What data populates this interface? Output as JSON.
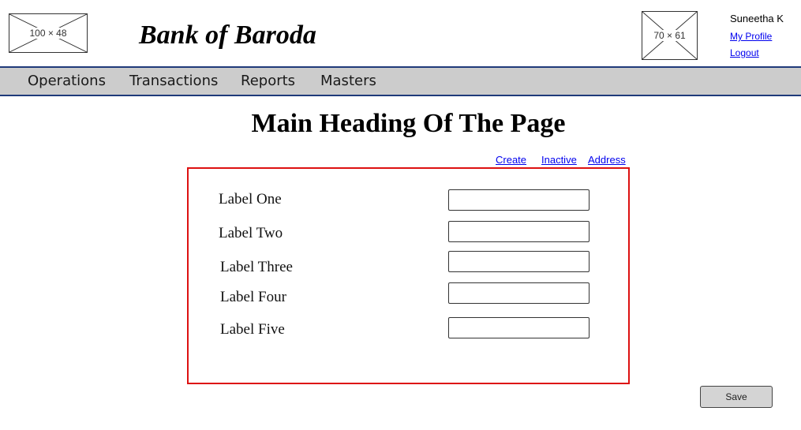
{
  "header": {
    "logo_placeholder": "100 × 48",
    "bank_name": "Bank of Baroda",
    "avatar_placeholder": "70 × 61",
    "user": {
      "name": "Suneetha K",
      "my_profile": "My Profile",
      "logout": "Logout"
    }
  },
  "nav": {
    "items": [
      {
        "label": "Operations"
      },
      {
        "label": "Transactions"
      },
      {
        "label": "Reports"
      },
      {
        "label": "Masters"
      }
    ]
  },
  "main": {
    "heading": "Main Heading Of The Page",
    "actions": [
      {
        "label": "Create"
      },
      {
        "label": "Inactive"
      },
      {
        "label": "Address"
      }
    ],
    "form": {
      "fields": [
        {
          "label": "Label One",
          "value": ""
        },
        {
          "label": "Label Two",
          "value": ""
        },
        {
          "label": "Label Three",
          "value": ""
        },
        {
          "label": "Label Four",
          "value": ""
        },
        {
          "label": "Label Five",
          "value": ""
        }
      ]
    },
    "save_label": "Save"
  },
  "colors": {
    "nav_background": "#cccccc",
    "nav_border": "#1f3a7a",
    "form_border": "#dd1111",
    "link": "#0000ee",
    "save_button": "#d4d4d4"
  }
}
